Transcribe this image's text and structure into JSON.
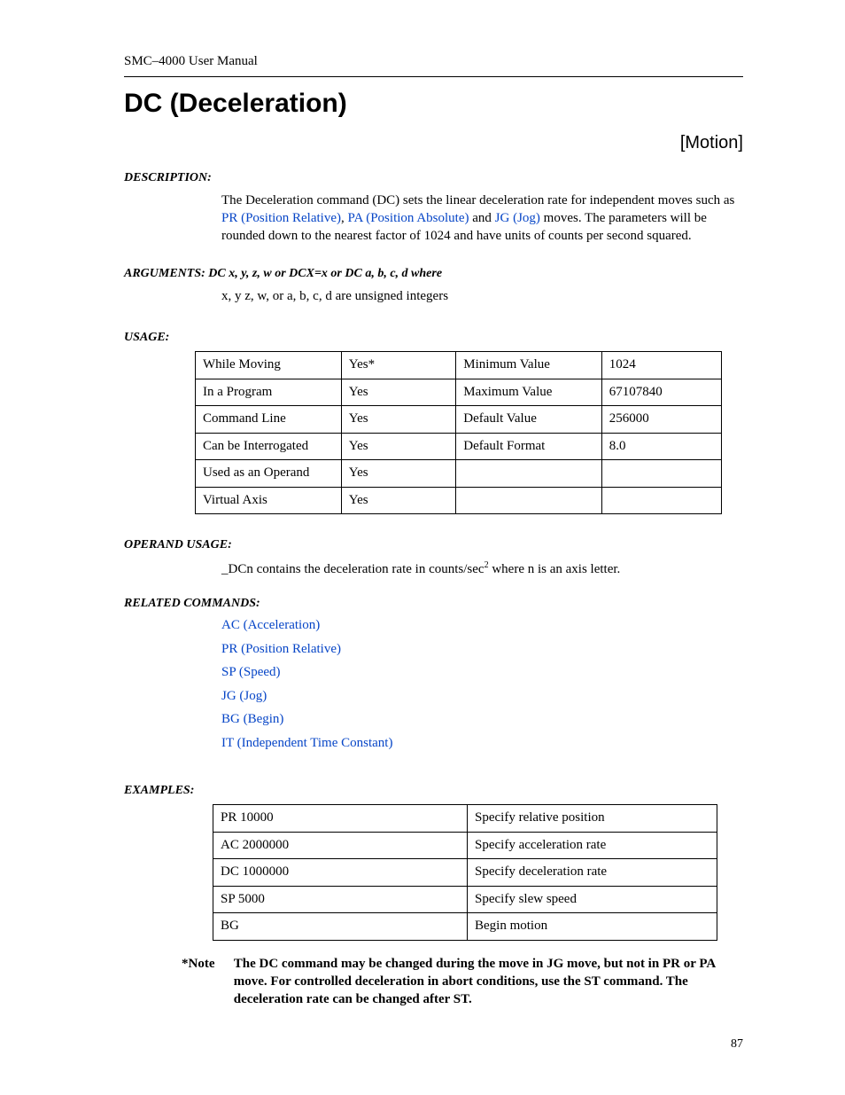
{
  "header": {
    "manual": "SMC–4000 User Manual"
  },
  "title": "DC (Deceleration)",
  "category": "[Motion]",
  "description": {
    "label": "DESCRIPTION:",
    "pre": "The Deceleration command (DC) sets the linear deceleration rate for independent moves such as ",
    "link1": "PR (Position Relative)",
    "sep1": ", ",
    "link2": "PA (Position Absolute)",
    "sep2": " and ",
    "link3": "JG (Jog)",
    "post": " moves. The parameters will be rounded down to the nearest factor of 1024 and have units of counts per second squared."
  },
  "arguments": {
    "label": "ARGUMENTS:  DC x, y, z, w or DCX=x or DC a, b, c, d   where",
    "body": "x, y z, w, or a, b, c, d are unsigned integers"
  },
  "usage": {
    "label": "USAGE:",
    "rows": [
      [
        "While Moving",
        "Yes*",
        "Minimum Value",
        "1024"
      ],
      [
        "In a Program",
        "Yes",
        "Maximum Value",
        "67107840"
      ],
      [
        "Command Line",
        "Yes",
        "Default Value",
        "256000"
      ],
      [
        "Can be Interrogated",
        "Yes",
        "Default Format",
        "8.0"
      ],
      [
        "Used as an Operand",
        "Yes",
        "",
        ""
      ],
      [
        "Virtual Axis",
        "Yes",
        "",
        ""
      ]
    ]
  },
  "operand": {
    "label": "OPERAND USAGE:",
    "pre": "_DCn contains the deceleration rate in counts/sec",
    "sup": "2",
    "post": " where n is an axis letter."
  },
  "related": {
    "label": "RELATED COMMANDS:",
    "items": [
      "AC (Acceleration)",
      "PR (Position Relative)",
      "SP (Speed)",
      "JG (Jog)",
      "BG (Begin)",
      "IT (Independent Time Constant)"
    ]
  },
  "examples": {
    "label": "EXAMPLES:",
    "rows": [
      [
        "PR 10000",
        "Specify relative position"
      ],
      [
        "AC 2000000",
        "Specify acceleration rate"
      ],
      [
        "DC 1000000",
        "Specify deceleration rate"
      ],
      [
        "SP 5000",
        "Specify slew speed"
      ],
      [
        "BG",
        "Begin motion"
      ]
    ]
  },
  "note": {
    "star": "*Note",
    "body": "The DC command may be changed during the move in JG move, but not in PR or PA move. For controlled deceleration in abort conditions, use the ST command. The deceleration rate can be changed after ST."
  },
  "page_number": "87"
}
